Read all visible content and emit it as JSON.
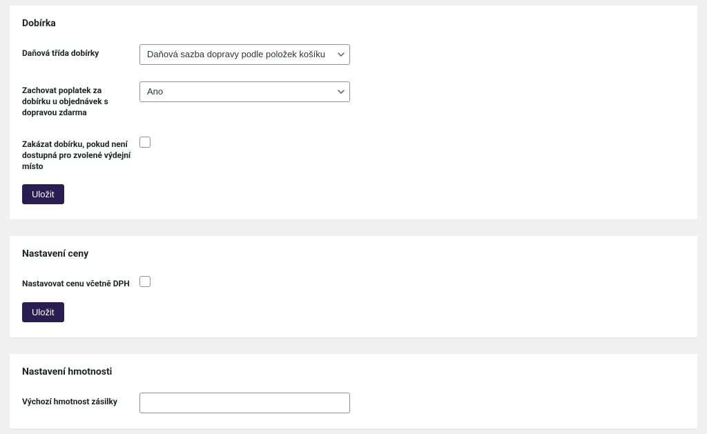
{
  "sections": {
    "cod": {
      "title": "Dobírka",
      "tax_class": {
        "label": "Daňová třída dobírky",
        "selected": "Daňová sazba dopravy podle položek košíku"
      },
      "keep_fee_free_shipping": {
        "label": "Zachovat poplatek za dobírku u objednávek s dopravou zdarma",
        "selected": "Ano"
      },
      "disable_cod_pickup": {
        "label": "Zakázat dobírku, pokud není dostupná pro zvolené výdejní místo"
      },
      "save_label": "Uložit"
    },
    "price": {
      "title": "Nastavení ceny",
      "price_with_vat": {
        "label": "Nastavovat cenu včetně DPH"
      },
      "save_label": "Uložit"
    },
    "weight": {
      "title": "Nastavení hmotnosti",
      "default_weight": {
        "label": "Výchozí hmotnost zásilky",
        "value": ""
      }
    }
  }
}
